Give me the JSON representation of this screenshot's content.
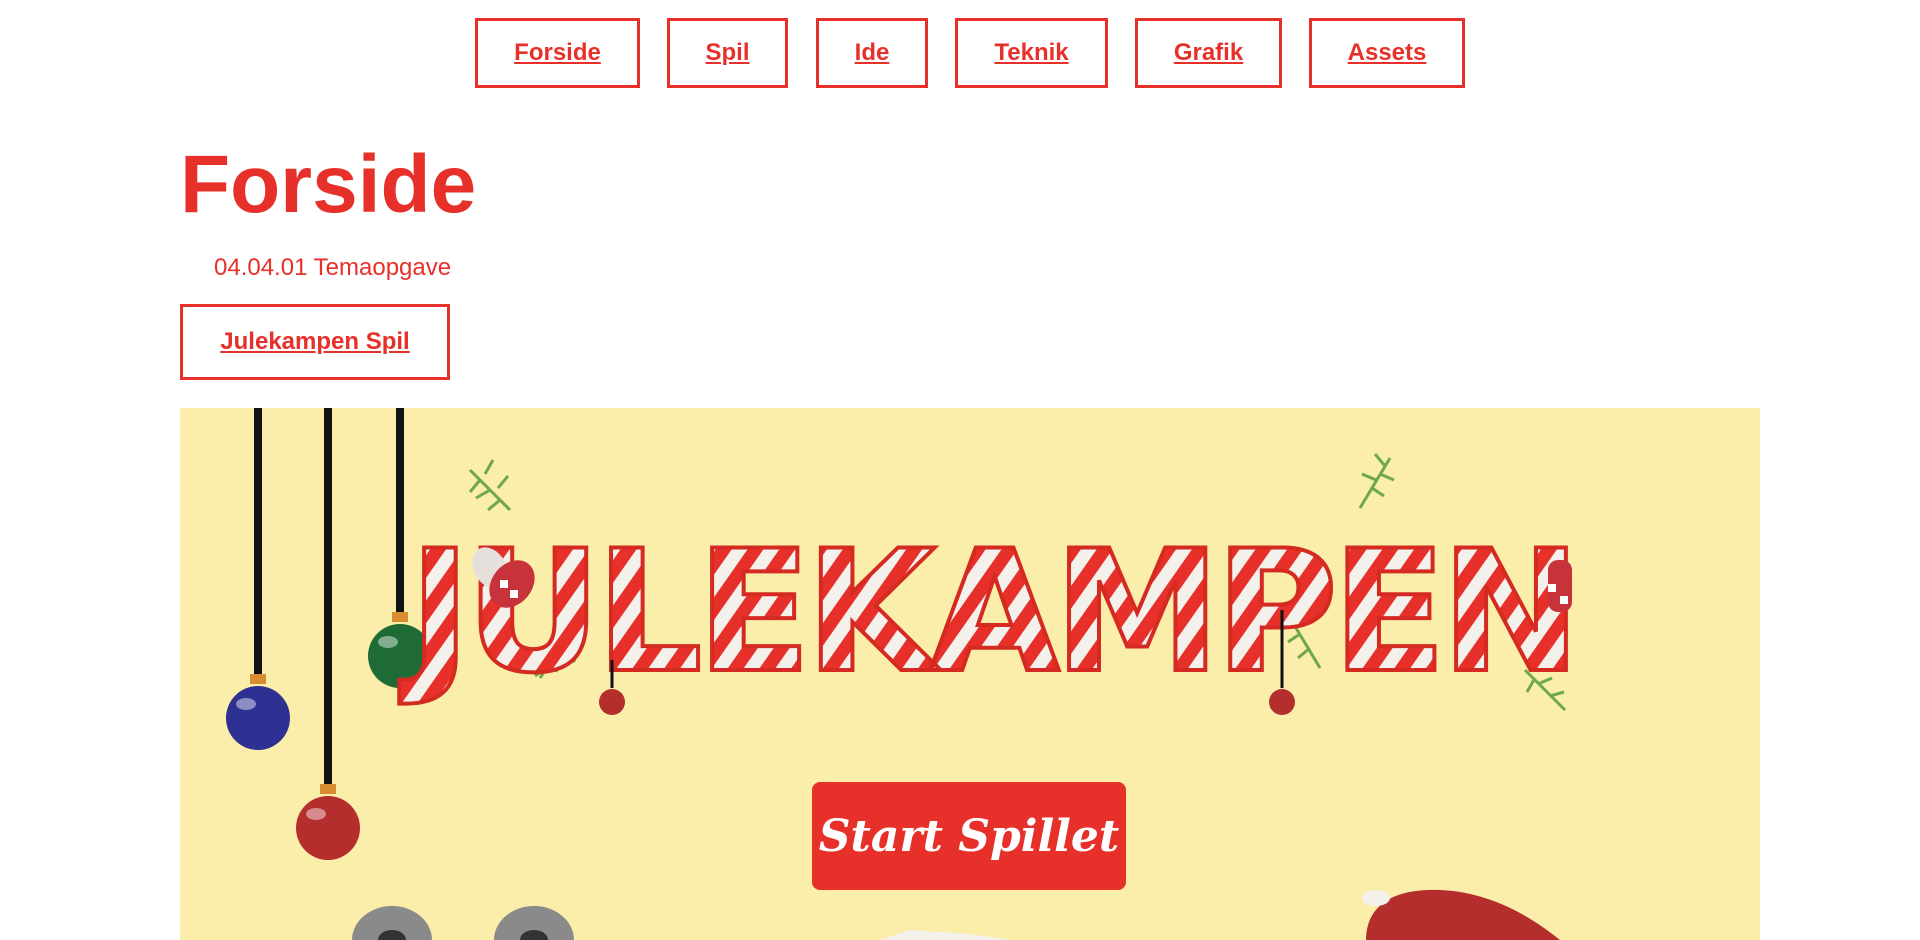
{
  "nav": {
    "items": [
      {
        "label": "Forside"
      },
      {
        "label": "Spil"
      },
      {
        "label": "Ide"
      },
      {
        "label": "Teknik"
      },
      {
        "label": "Grafik"
      },
      {
        "label": "Assets"
      }
    ]
  },
  "page": {
    "title": "Forside",
    "subtitle": "04.04.01 Temaopgave",
    "game_link_label": "Julekampen Spil"
  },
  "game": {
    "logo_text": "JULEKAMPEN",
    "start_label": "Start Spillet",
    "colors": {
      "background": "#fbeeaa",
      "accent": "#e8302a",
      "ornament_blue": "#2e3192",
      "ornament_green": "#1e6b35",
      "ornament_red": "#b52e2e"
    }
  }
}
